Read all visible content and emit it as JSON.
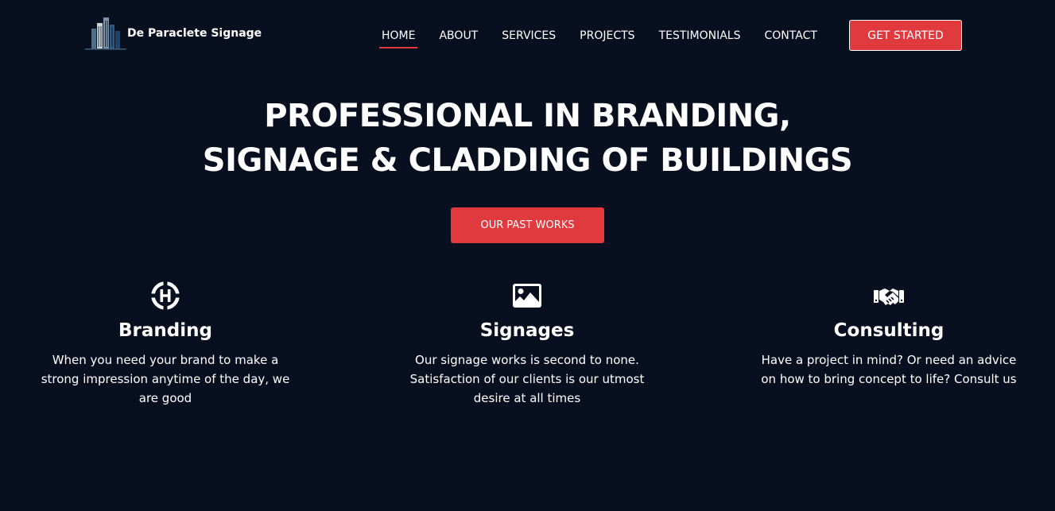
{
  "header": {
    "brand_name": "De Paraclete Signage",
    "logo_icon": "building-logo-icon",
    "nav": [
      {
        "label": "HOME",
        "active": true
      },
      {
        "label": "ABOUT",
        "active": false
      },
      {
        "label": "SERVICES",
        "active": false
      },
      {
        "label": "PROJECTS",
        "active": false
      },
      {
        "label": "TESTIMONIALS",
        "active": false
      },
      {
        "label": "CONTACT",
        "active": false
      }
    ],
    "cta_label": "GET STARTED"
  },
  "hero": {
    "title_line1": "PROFESSIONAL IN BRANDING,",
    "title_line2": "SIGNAGE & CLADDING OF BUILDINGS",
    "cta_label": "OUR PAST WORKS"
  },
  "features": [
    {
      "icon": "helipad-icon",
      "title": "Branding",
      "text": "When you need your brand to make a strong impression anytime of the day, we are good"
    },
    {
      "icon": "image-icon",
      "title": "Signages",
      "text": "Our signage works is second to none. Satisfaction of our clients is our utmost desire at all times"
    },
    {
      "icon": "handshake-icon",
      "title": "Consulting",
      "text": "Have a project in mind? Or need an advice on how to bring concept to life? Consult us"
    }
  ],
  "colors": {
    "background": "#081020",
    "accent": "#e03a3e",
    "text": "#ffffff"
  }
}
